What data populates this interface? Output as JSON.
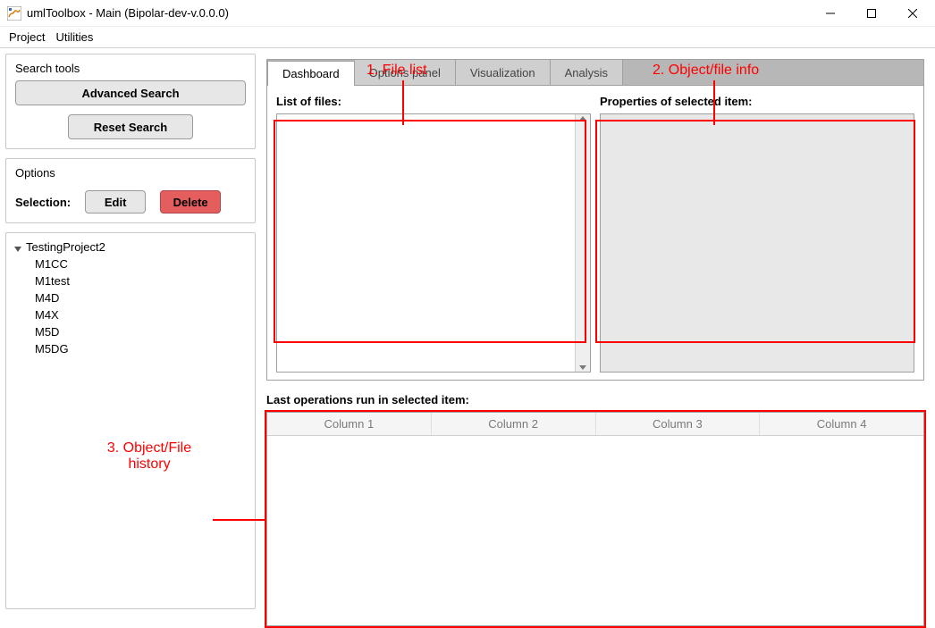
{
  "window": {
    "title": "umlToolbox - Main  (Bipolar-dev-v.0.0.0)"
  },
  "menu": {
    "project": "Project",
    "utilities": "Utilities"
  },
  "sidebar": {
    "search": {
      "title": "Search tools",
      "advanced": "Advanced Search",
      "reset": "Reset Search"
    },
    "options": {
      "title": "Options",
      "selection_label": "Selection:",
      "edit": "Edit",
      "delete": "Delete"
    },
    "tree": {
      "root": "TestingProject2",
      "children": [
        "M1CC",
        "M1test",
        "M4D",
        "M4X",
        "M5D",
        "M5DG"
      ]
    }
  },
  "tabs": {
    "items": [
      "Dashboard",
      "Options panel",
      "Visualization",
      "Analysis"
    ],
    "active_index": 0
  },
  "dashboard": {
    "list_label": "List of files:",
    "props_label": "Properties of selected item:",
    "history_label": "Last operations run in selected item:",
    "columns": [
      "Column 1",
      "Column 2",
      "Column 3",
      "Column 4"
    ]
  },
  "annotations": {
    "a1": "1. File list",
    "a2": "2. Object/file info",
    "a3_line1": "3. Object/File",
    "a3_line2": "history"
  }
}
